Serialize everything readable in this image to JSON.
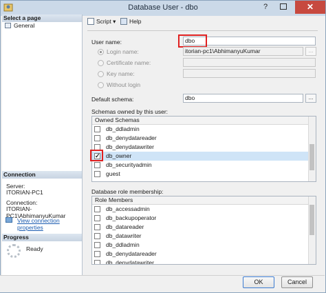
{
  "window": {
    "title": "Database User - dbo",
    "close_glyph": "✕",
    "help_glyph": "?"
  },
  "left": {
    "select_page_header": "Select a page",
    "pages": [
      "General"
    ],
    "connection_header": "Connection",
    "server_label": "Server:",
    "server_value": "ITORIAN-PC1",
    "connection_label": "Connection:",
    "connection_value": "ITORIAN-PC1\\AbhimanyuKumar",
    "view_link": "View connection properties",
    "progress_header": "Progress",
    "progress_status": "Ready"
  },
  "toolbar": {
    "script_label": "Script",
    "script_arrow": "▾",
    "help_label": "Help"
  },
  "form": {
    "user_name_label": "User name:",
    "user_name_value": "dbo",
    "login_name_label": "Login name:",
    "login_name_value": "itorian-pc1\\AbhimanyuKumar",
    "certificate_label": "Certificate name:",
    "key_label": "Key name:",
    "without_login_label": "Without login",
    "default_schema_label": "Default schema:",
    "default_schema_value": "dbo",
    "ellipsis": "..."
  },
  "schemas": {
    "section_label": "Schemas owned by this user:",
    "column_header": "Owned Schemas",
    "rows": [
      {
        "name": "db_ddladmin",
        "checked": false
      },
      {
        "name": "db_denydatareader",
        "checked": false
      },
      {
        "name": "db_denydatawriter",
        "checked": false
      },
      {
        "name": "db_owner",
        "checked": true
      },
      {
        "name": "db_securityadmin",
        "checked": false
      },
      {
        "name": "guest",
        "checked": false
      }
    ]
  },
  "roles": {
    "section_label": "Database role membership:",
    "column_header": "Role Members",
    "rows": [
      {
        "name": "db_accessadmin",
        "checked": false
      },
      {
        "name": "db_backupoperator",
        "checked": false
      },
      {
        "name": "db_datareader",
        "checked": false
      },
      {
        "name": "db_datawriter",
        "checked": false
      },
      {
        "name": "db_ddladmin",
        "checked": false
      },
      {
        "name": "db_denydatareader",
        "checked": false
      },
      {
        "name": "db_denydatawriter",
        "checked": false
      }
    ]
  },
  "buttons": {
    "ok": "OK",
    "cancel": "Cancel"
  },
  "colors": {
    "highlight": "#e02020",
    "selection": "#cfe4f7",
    "link": "#1a5bb0"
  }
}
